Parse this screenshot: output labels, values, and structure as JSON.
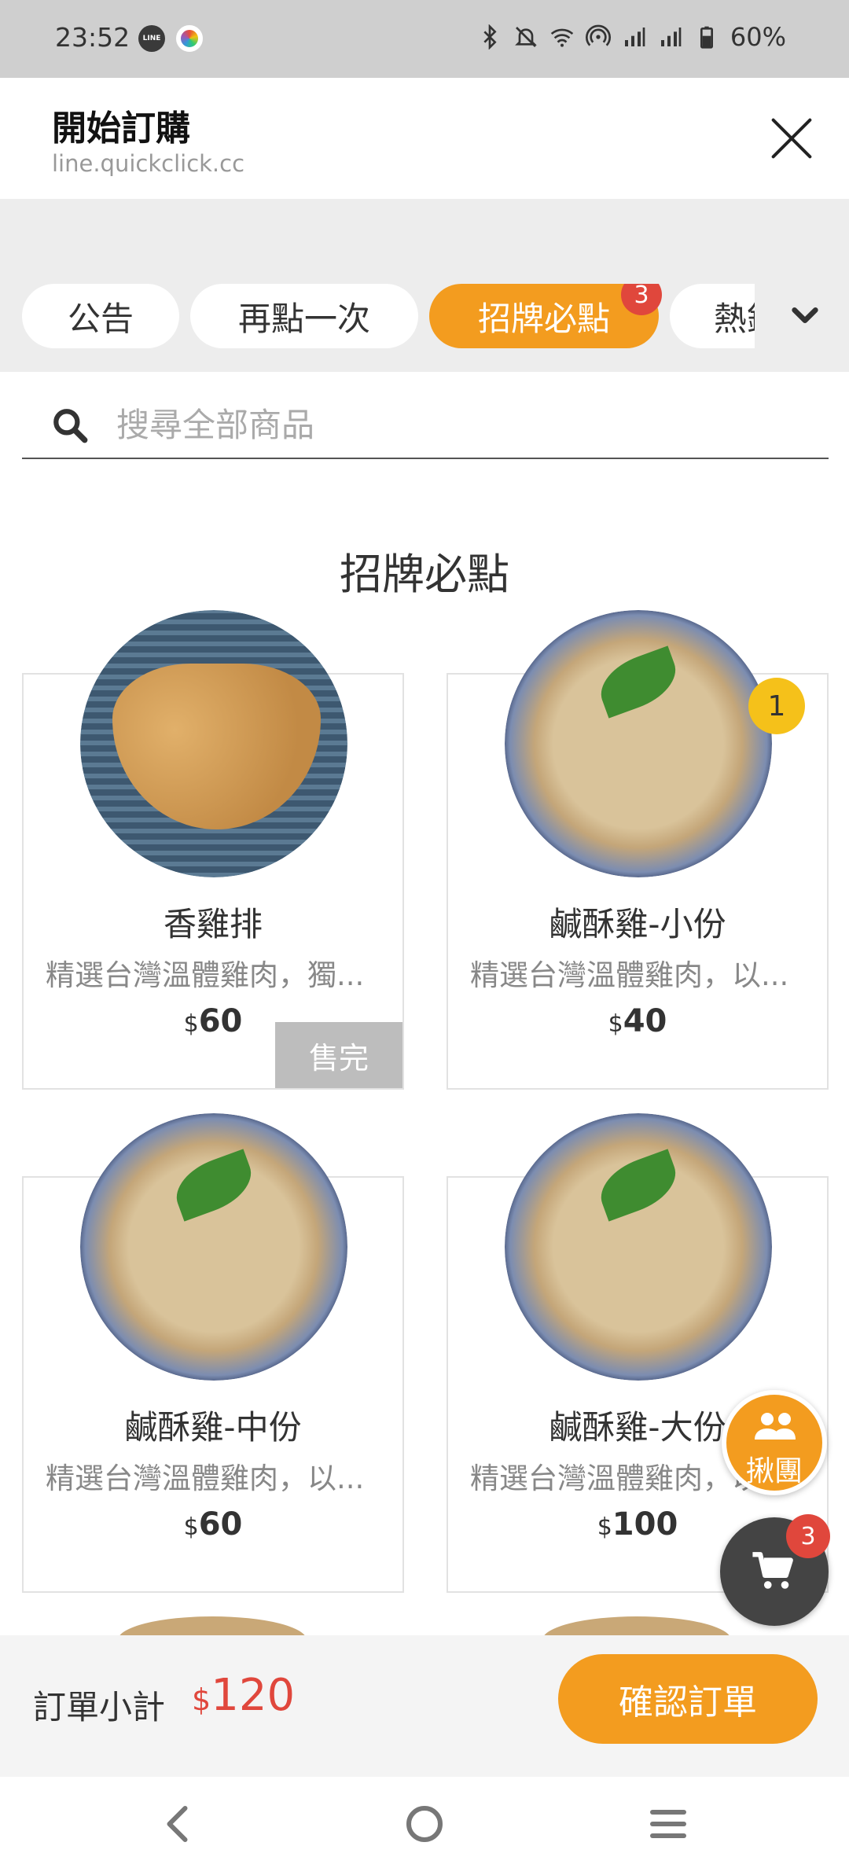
{
  "status_bar": {
    "time": "23:52",
    "battery": "60%",
    "icons": [
      "line-app-icon",
      "multicolor-app-icon",
      "bluetooth-icon",
      "mute-icon",
      "wifi-icon",
      "hotspot-icon",
      "signal-icon",
      "signal-icon",
      "battery-icon"
    ]
  },
  "header": {
    "title": "開始訂購",
    "url": "line.quickclick.cc"
  },
  "tabs": [
    {
      "label": "公告",
      "active": false
    },
    {
      "label": "再點一次",
      "active": false
    },
    {
      "label": "招牌必點",
      "active": true,
      "badge": "3"
    },
    {
      "label": "熱銷",
      "active": false
    }
  ],
  "search": {
    "placeholder": "搜尋全部商品"
  },
  "section": {
    "title": "招牌必點"
  },
  "products": [
    {
      "name": "香雞排",
      "desc": "精選台灣溫體雞肉，獨...",
      "currency": "$",
      "price": "60",
      "status": "售完"
    },
    {
      "name": "鹹酥雞-小份",
      "desc": "精選台灣溫體雞肉，以...",
      "currency": "$",
      "price": "40",
      "qty": "1"
    },
    {
      "name": "鹹酥雞-中份",
      "desc": "精選台灣溫體雞肉，以...",
      "currency": "$",
      "price": "60"
    },
    {
      "name": "鹹酥雞-大份",
      "desc": "精選台灣溫體雞肉，以...",
      "currency": "$",
      "price": "100"
    }
  ],
  "fab": {
    "group_label": "揪團",
    "cart_badge": "3"
  },
  "order": {
    "subtotal_label": "訂單小計",
    "currency": "$",
    "subtotal": "120",
    "confirm_label": "確認訂單"
  },
  "colors": {
    "accent": "#f39c1f",
    "badge_red": "#e0473c",
    "qty_yellow": "#f5c11a",
    "soldout_gray": "#bdbdbd"
  }
}
